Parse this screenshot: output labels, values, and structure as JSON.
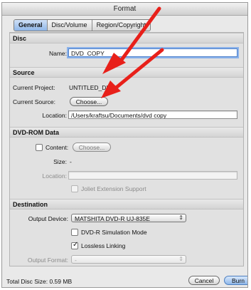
{
  "window": {
    "title": "Format"
  },
  "tabs": [
    {
      "label": "General"
    },
    {
      "label": "Disc/Volume"
    },
    {
      "label": "Region/Copyright"
    }
  ],
  "disc": {
    "section_title": "Disc",
    "name_label": "Name:",
    "name_value": "DVD_COPY"
  },
  "source": {
    "section_title": "Source",
    "current_project_label": "Current Project:",
    "current_project_value": "UNTITLED_DISC",
    "current_source_label": "Current Source:",
    "choose_label": "Choose...",
    "location_label": "Location:",
    "location_value": "/Users/kraftsu/Documents/dvd copy"
  },
  "dvdrom": {
    "section_title": "DVD-ROM Data",
    "content_label": "Content:",
    "choose_label": "Choose...",
    "size_label": "Size:",
    "size_value": "-",
    "location_label": "Location:",
    "location_value": "",
    "joliet_label": "Joliet Extension Support"
  },
  "destination": {
    "section_title": "Destination",
    "output_device_label": "Output Device:",
    "output_device_value": "MATSHITA DVD-R UJ-835E",
    "simulation_label": "DVD-R Simulation Mode",
    "lossless_label": "Lossless Linking",
    "output_format_label": "Output Format:",
    "output_format_value": "-"
  },
  "footer": {
    "total_size": "Total Disc Size: 0.59 MB",
    "cancel_label": "Cancel",
    "burn_label": "Burn"
  },
  "icons": {
    "select_arrow": "⇕",
    "checkmark": "✓"
  },
  "states": {
    "simulation_checked": false,
    "lossless_checked": true,
    "content_checked": false,
    "joliet_checked": false
  },
  "colors": {
    "annotation_arrow": "#e8201a",
    "focus_ring": "#8bb2ea",
    "active_tab": "#8fb6e8"
  }
}
